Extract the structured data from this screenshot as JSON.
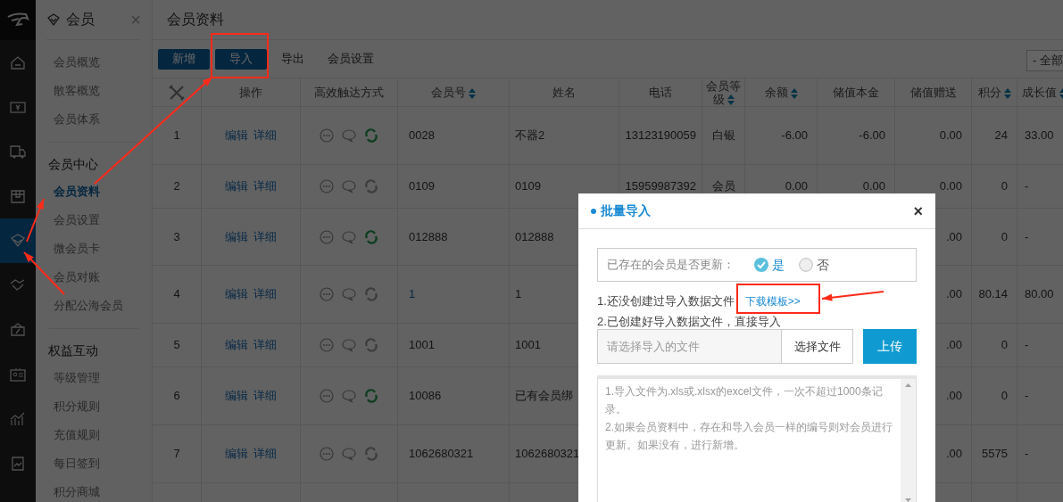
{
  "icon_bar": {
    "items": [
      {
        "selected": false
      },
      {
        "selected": false
      },
      {
        "selected": false
      },
      {
        "selected": false
      },
      {
        "selected": true
      },
      {
        "selected": false
      },
      {
        "selected": false
      },
      {
        "selected": false
      },
      {
        "selected": false
      },
      {
        "selected": false
      }
    ]
  },
  "nav": {
    "title": "会员",
    "close": "×",
    "sections": [
      {
        "items": [
          {
            "label": "会员概览",
            "selected": false
          },
          {
            "label": "散客概览",
            "selected": false
          },
          {
            "label": "会员体系",
            "selected": false
          }
        ]
      },
      {
        "heading": "会员中心",
        "items": [
          {
            "label": "会员资料",
            "selected": true
          },
          {
            "label": "会员设置",
            "selected": false
          },
          {
            "label": "微会员卡",
            "selected": false
          },
          {
            "label": "会员对账",
            "selected": false
          },
          {
            "label": "分配公海会员",
            "selected": false
          }
        ]
      },
      {
        "heading": "权益互动",
        "items": [
          {
            "label": "等级管理",
            "selected": false
          },
          {
            "label": "积分规则",
            "selected": false
          },
          {
            "label": "充值规则",
            "selected": false
          },
          {
            "label": "每日签到",
            "selected": false
          },
          {
            "label": "积分商城",
            "selected": false
          }
        ]
      }
    ]
  },
  "page_title": "会员资料",
  "toolbar": {
    "buttons": [
      {
        "label": "新增",
        "kind": "primary"
      },
      {
        "label": "导入",
        "kind": "primary"
      },
      {
        "label": "导出",
        "kind": "plain"
      },
      {
        "label": "会员设置",
        "kind": "plain"
      }
    ],
    "filter": "- 全部"
  },
  "table": {
    "columns": [
      {
        "kind": "icon",
        "sortable": false
      },
      {
        "label": "操作",
        "sortable": false
      },
      {
        "label": "高效触达方式",
        "sortable": false
      },
      {
        "label": "会员号",
        "sortable": true
      },
      {
        "label": "姓名",
        "sortable": false
      },
      {
        "label": "电话",
        "sortable": false
      },
      {
        "label": "会员等级",
        "sortable": true
      },
      {
        "label": "余额",
        "sortable": true
      },
      {
        "label": "储值本金",
        "sortable": false
      },
      {
        "label": "储值赠送",
        "sortable": false
      },
      {
        "label": "积分",
        "sortable": true
      },
      {
        "label": "成长值",
        "sortable": true
      }
    ],
    "rows": [
      {
        "cells": [
          "1",
          {
            "links": [
              "编辑",
              "详细"
            ]
          },
          {
            "reach_active": true
          },
          "0028",
          "不器2",
          "13123190059",
          "白银",
          "-6.00",
          "-6.00",
          "0.00",
          "24",
          "33.00"
        ]
      },
      {
        "cells": [
          "2",
          {
            "links": [
              "编辑",
              "详细"
            ]
          },
          {
            "reach_active": false
          },
          "0109",
          "0109",
          "15959987392",
          "会员",
          "0.00",
          "0.00",
          "0.00",
          "0",
          "-"
        ]
      },
      {
        "cells": [
          "3",
          {
            "links": [
              "编辑",
              "详细"
            ]
          },
          {
            "reach_active": true
          },
          "012888",
          "012888",
          null,
          null,
          null,
          null,
          ".00",
          "0",
          "-"
        ]
      },
      {
        "cells": [
          "4",
          {
            "links": [
              "编辑",
              "详细"
            ]
          },
          {
            "reach_active": false
          },
          "1",
          "1",
          null,
          null,
          null,
          null,
          ".00",
          "80.14",
          "80.00"
        ]
      },
      {
        "cells": [
          "5",
          {
            "links": [
              "编辑",
              "详细"
            ]
          },
          {
            "reach_active": false
          },
          "1001",
          "1001",
          null,
          null,
          null,
          null,
          ".00",
          "0",
          "-"
        ]
      },
      {
        "cells": [
          "6",
          {
            "links": [
              "编辑",
              "详细"
            ]
          },
          {
            "reach_active": true
          },
          "10086",
          "已有会员绑",
          null,
          null,
          null,
          null,
          ".00",
          "0",
          "-"
        ]
      },
      {
        "cells": [
          "7",
          {
            "links": [
              "编辑",
              "详细"
            ]
          },
          {
            "reach_active": false
          },
          "1062680321",
          "1062680321",
          null,
          null,
          null,
          null,
          ".00",
          "5575",
          "-"
        ]
      }
    ]
  },
  "dialog": {
    "title": "批量导入",
    "close": "×",
    "question": "已存在的会员是否更新：",
    "options": [
      {
        "label": "是",
        "selected": true
      },
      {
        "label": "否",
        "selected": false
      }
    ],
    "step1": "1.还没创建过导入数据文件",
    "template_link": "下载模板>>",
    "step2": "2.已创建好导入数据文件，直接导入",
    "file_placeholder": "请选择导入的文件",
    "choose_button": "选择文件",
    "upload_button": "上传",
    "notes": "1.导入文件为.xls或.xlsx的excel文件，一次不超过1000条记录。\n2.如果会员资料中，存在和导入会员一样的编号则对会员进行更新。如果没有，进行新增。"
  }
}
